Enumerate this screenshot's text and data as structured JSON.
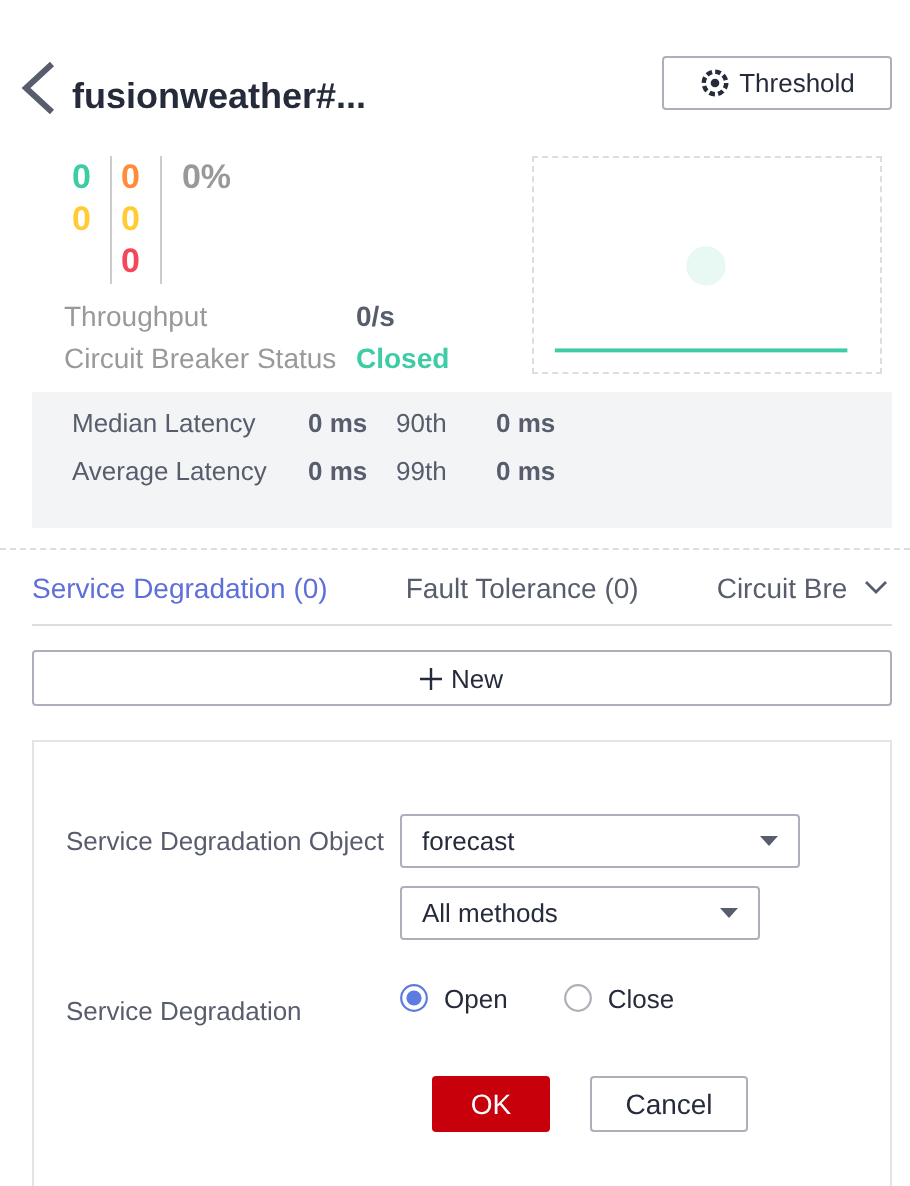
{
  "header": {
    "title": "fusionweather#...",
    "threshold_button": "Threshold"
  },
  "counters": [
    {
      "values": [
        {
          "text": "0",
          "color": "#3dcca6"
        },
        {
          "text": "0",
          "color": "#ffcc33"
        }
      ]
    },
    {
      "values": [
        {
          "text": "0",
          "color": "#ff8c3a"
        },
        {
          "text": "0",
          "color": "#ffcc33"
        },
        {
          "text": "0",
          "color": "#f5475a"
        }
      ]
    }
  ],
  "percent": "0%",
  "stats": [
    {
      "label": "Throughput",
      "value": "0/s",
      "kind": "plain"
    },
    {
      "label": "Circuit Breaker Status",
      "value": "Closed",
      "kind": "status"
    }
  ],
  "latency": [
    {
      "label": "Median Latency",
      "value": "0 ms",
      "pct_label": "90th",
      "pct_value": "0 ms"
    },
    {
      "label": "Average Latency",
      "value": "0 ms",
      "pct_label": "99th",
      "pct_value": "0 ms"
    }
  ],
  "tabs": [
    {
      "label": "Service Degradation (0)",
      "selected": true
    },
    {
      "label": "Fault Tolerance (0)",
      "selected": false
    },
    {
      "label": "Circuit Bre",
      "selected": false
    }
  ],
  "new_button": "New",
  "form": {
    "object_label": "Service Degradation Object",
    "object_select": "forecast",
    "method_select": "All methods",
    "degradation_label": "Service Degradation",
    "options": [
      {
        "label": "Open",
        "selected": true
      },
      {
        "label": "Close",
        "selected": false
      }
    ],
    "ok_button": "OK",
    "cancel_button": "Cancel"
  }
}
